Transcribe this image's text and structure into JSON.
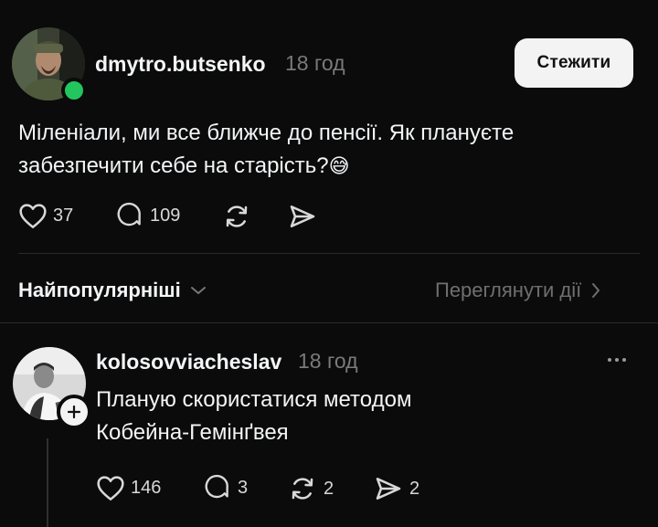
{
  "post": {
    "username": "dmytro.butsenko",
    "time": "18 год",
    "follow_label": "Стежити",
    "text_line1": "Міленіали, ми все ближче до пенсії. Як плануєте",
    "text_line2": "забезпечити себе на старість?",
    "emoji": "😅",
    "likes": "37",
    "comments": "109",
    "online_color": "#22c55e"
  },
  "filter": {
    "sort_label": "Найпопулярніші",
    "view_activity_label": "Переглянути дії"
  },
  "reply": {
    "username": "kolosovviacheslav",
    "time": "18 год",
    "text_line1": "Планую скористатися методом",
    "text_line2": "Кобейна-Гемінґвея",
    "likes": "146",
    "comments": "3",
    "reposts": "2",
    "shares": "2"
  },
  "icons": {
    "like": "heart-icon",
    "comment": "comment-bubble-icon",
    "repost": "repost-icon",
    "share": "send-icon",
    "more": "more-dots-icon",
    "chevron_down": "chevron-down-icon",
    "chevron_right": "chevron-right-icon",
    "add": "plus-icon"
  }
}
